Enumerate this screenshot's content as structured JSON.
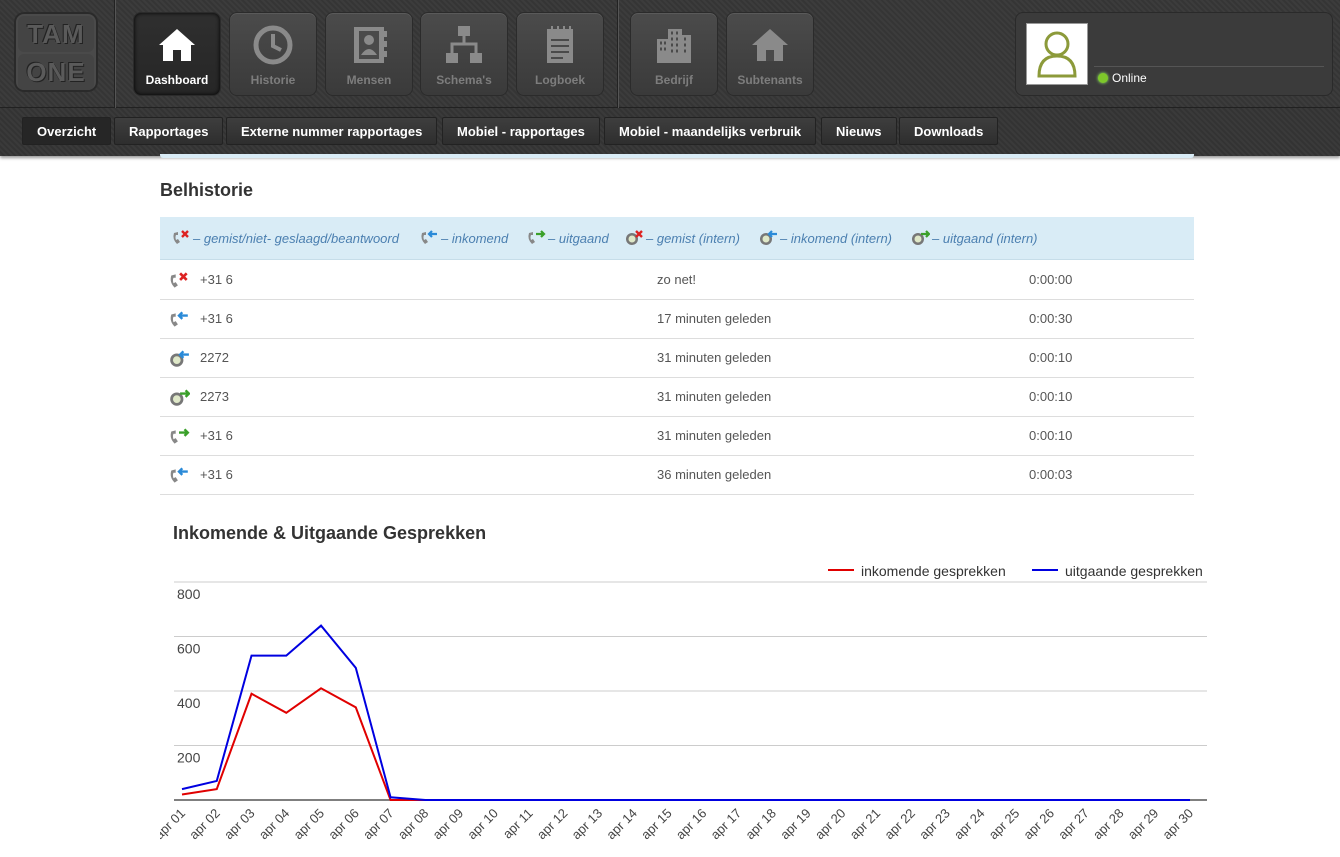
{
  "logo": {
    "line1": "TAM",
    "line2": "ONE"
  },
  "nav": [
    {
      "label": "Dashboard",
      "icon": "home-icon",
      "active": true
    },
    {
      "label": "Historie",
      "icon": "clock-icon",
      "active": false
    },
    {
      "label": "Mensen",
      "icon": "address-book-icon",
      "active": false
    },
    {
      "label": "Schema's",
      "icon": "flowchart-icon",
      "active": false
    },
    {
      "label": "Logboek",
      "icon": "notepad-icon",
      "active": false
    },
    {
      "label": "Bedrijf",
      "icon": "buildings-icon",
      "active": false
    },
    {
      "label": "Subtenants",
      "icon": "house-icon",
      "active": false
    }
  ],
  "user": {
    "status": "Online",
    "avatar": "user-avatar-icon"
  },
  "subnav": [
    "Overzicht",
    "Rapportages",
    "Externe nummer rapportages",
    "Mobiel - rapportages",
    "Mobiel - maandelijks verbruik",
    "Nieuws",
    "Downloads"
  ],
  "belhistorie": {
    "title": "Belhistorie",
    "legend": [
      {
        "icon": "missed-call-icon",
        "text": "– gemist/niet- geslaagd/beantwoord"
      },
      {
        "icon": "incoming-call-icon",
        "text": "– inkomend"
      },
      {
        "icon": "outgoing-call-icon",
        "text": "– uitgaand"
      },
      {
        "icon": "missed-internal-icon",
        "text": "– gemist (intern)"
      },
      {
        "icon": "incoming-internal-icon",
        "text": "– inkomend (intern)"
      },
      {
        "icon": "outgoing-internal-icon",
        "text": "– uitgaand (intern)"
      }
    ],
    "rows": [
      {
        "type": "missed-call-icon",
        "number": "+31 6",
        "when": "zo net!",
        "duration": "0:00:00"
      },
      {
        "type": "incoming-call-icon",
        "number": "+31 6",
        "when": "17 minuten geleden",
        "duration": "0:00:30"
      },
      {
        "type": "incoming-internal-icon",
        "number": "2272",
        "when": "31 minuten geleden",
        "duration": "0:00:10"
      },
      {
        "type": "outgoing-internal-icon",
        "number": "2273",
        "when": "31 minuten geleden",
        "duration": "0:00:10"
      },
      {
        "type": "outgoing-call-icon",
        "number": "+31 6",
        "when": "31 minuten geleden",
        "duration": "0:00:10"
      },
      {
        "type": "incoming-call-icon",
        "number": "+31 6",
        "when": "36 minuten geleden",
        "duration": "0:00:03"
      }
    ]
  },
  "colors": {
    "incoming": "#e00000",
    "outgoing": "#0000e0",
    "accent_bg": "#d9ecf6",
    "legend_text": "#4b7fb0"
  },
  "chart_data": {
    "type": "line",
    "title": "Inkomende & Uitgaande Gesprekken",
    "legend_position": "top-right",
    "categories": [
      "apr 01",
      "apr 02",
      "apr 03",
      "apr 04",
      "apr 05",
      "apr 06",
      "apr 07",
      "apr 08",
      "apr 09",
      "apr 10",
      "apr 11",
      "apr 12",
      "apr 13",
      "apr 14",
      "apr 15",
      "apr 16",
      "apr 17",
      "apr 18",
      "apr 19",
      "apr 20",
      "apr 21",
      "apr 22",
      "apr 23",
      "apr 24",
      "apr 25",
      "apr 26",
      "apr 27",
      "apr 28",
      "apr 29",
      "apr 30"
    ],
    "yticks": [
      200,
      400,
      600,
      800
    ],
    "ylim": [
      0,
      800
    ],
    "grid": true,
    "series": [
      {
        "name": "inkomende gesprekken",
        "color": "#e00000",
        "values": [
          20,
          40,
          390,
          320,
          410,
          340,
          0,
          0,
          0,
          0,
          0,
          0,
          0,
          0,
          0,
          0,
          0,
          0,
          0,
          0,
          0,
          0,
          0,
          0,
          0,
          0,
          0,
          0,
          0,
          0
        ]
      },
      {
        "name": "uitgaande gesprekken",
        "color": "#0000e0",
        "values": [
          40,
          70,
          530,
          530,
          640,
          485,
          10,
          0,
          0,
          0,
          0,
          0,
          0,
          0,
          0,
          0,
          0,
          0,
          0,
          0,
          0,
          0,
          0,
          0,
          0,
          0,
          0,
          0,
          0,
          0
        ]
      }
    ]
  }
}
